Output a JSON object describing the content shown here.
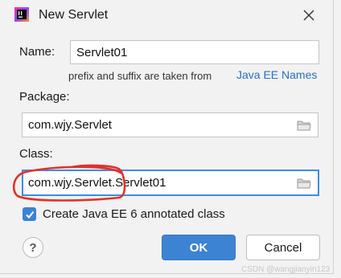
{
  "dialog": {
    "title": "New Servlet",
    "icon": "intellij-idea-icon",
    "close_icon": "close-icon"
  },
  "form": {
    "name_label": "Name:",
    "name_value": "Servlet01",
    "hint_text": "prefix and suffix are taken from",
    "hint_link": "Java EE Names",
    "package_label": "Package:",
    "package_value": "com.wjy.Servlet",
    "class_label": "Class:",
    "class_value": "com.wjy.Servlet.Servlet01",
    "checkbox_label": "Create Java EE 6 annotated class",
    "checkbox_checked": true
  },
  "buttons": {
    "help": "?",
    "ok": "OK",
    "cancel": "Cancel"
  },
  "watermark": "CSDN @wangjianyin123",
  "colors": {
    "accent": "#3d83d3",
    "link": "#2a6fc4",
    "annotation": "#e0312a"
  }
}
